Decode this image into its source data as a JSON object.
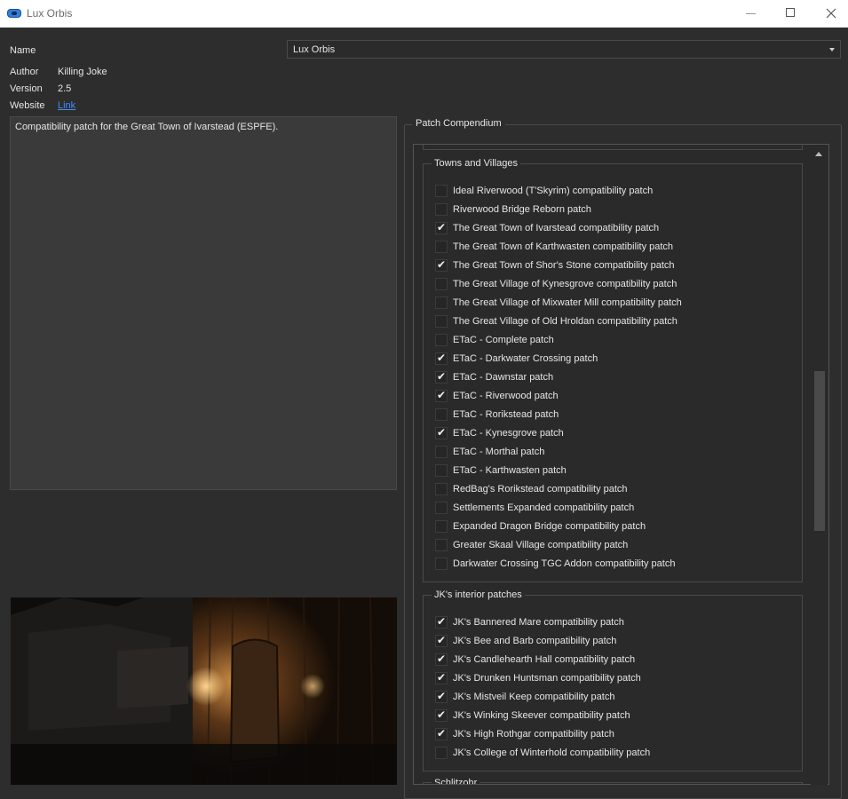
{
  "window": {
    "title": "Lux Orbis",
    "app_icon": "lux-orbis-icon",
    "controls": [
      "minimize-icon",
      "maximize-icon",
      "close-icon"
    ]
  },
  "info": {
    "name_label": "Name",
    "name_value": "Lux Orbis",
    "author_label": "Author",
    "author_value": "Killing Joke",
    "version_label": "Version",
    "version_value": "2.5",
    "website_label": "Website",
    "website_link": "Link",
    "link_color": "#3f8dfd"
  },
  "description": "Compatibility patch for the Great Town of Ivarstead (ESPFE).",
  "compendium": {
    "title": "Patch Compendium",
    "groups": [
      {
        "title": "Towns and Villages",
        "items": [
          {
            "label": "Ideal Riverwood (T'Skyrim) compatibility patch",
            "checked": false
          },
          {
            "label": "Riverwood Bridge Reborn patch",
            "checked": false
          },
          {
            "label": "The Great Town of Ivarstead compatibility patch",
            "checked": true
          },
          {
            "label": "The Great Town of Karthwasten compatibility patch",
            "checked": false
          },
          {
            "label": "The Great Town of Shor's Stone compatibility patch",
            "checked": true
          },
          {
            "label": "The Great Village of Kynesgrove compatibility patch",
            "checked": false
          },
          {
            "label": "The Great Village of Mixwater Mill compatibility patch",
            "checked": false
          },
          {
            "label": "The Great Village of Old Hroldan compatibility patch",
            "checked": false
          },
          {
            "label": "ETaC - Complete patch",
            "checked": false
          },
          {
            "label": "ETaC - Darkwater Crossing patch",
            "checked": true
          },
          {
            "label": "ETaC - Dawnstar patch",
            "checked": true
          },
          {
            "label": "ETaC - Riverwood patch",
            "checked": true
          },
          {
            "label": "ETaC - Rorikstead patch",
            "checked": false
          },
          {
            "label": "ETaC - Kynesgrove patch",
            "checked": true
          },
          {
            "label": "ETaC - Morthal patch",
            "checked": false
          },
          {
            "label": "ETaC - Karthwasten patch",
            "checked": false
          },
          {
            "label": "RedBag's Rorikstead compatibility patch",
            "checked": false
          },
          {
            "label": "Settlements Expanded compatibility patch",
            "checked": false
          },
          {
            "label": "Expanded Dragon Bridge compatibility patch",
            "checked": false
          },
          {
            "label": "Greater Skaal Village compatibility patch",
            "checked": false
          },
          {
            "label": "Darkwater Crossing TGC Addon compatibility patch",
            "checked": false
          }
        ]
      },
      {
        "title": "JK's interior patches",
        "items": [
          {
            "label": "JK's Bannered Mare compatibility patch",
            "checked": true
          },
          {
            "label": "JK's Bee and Barb compatibility patch",
            "checked": true
          },
          {
            "label": "JK's Candlehearth Hall compatibility patch",
            "checked": true
          },
          {
            "label": "JK's Drunken Huntsman compatibility patch",
            "checked": true
          },
          {
            "label": "JK's Mistveil Keep compatibility patch",
            "checked": true
          },
          {
            "label": "JK's Winking Skeever compatibility patch",
            "checked": true
          },
          {
            "label": "JK's High Rothgar compatibility patch",
            "checked": true
          },
          {
            "label": "JK's College of Winterhold compatibility patch",
            "checked": false
          }
        ]
      },
      {
        "title": "Schlitzohr",
        "items": []
      }
    ]
  }
}
